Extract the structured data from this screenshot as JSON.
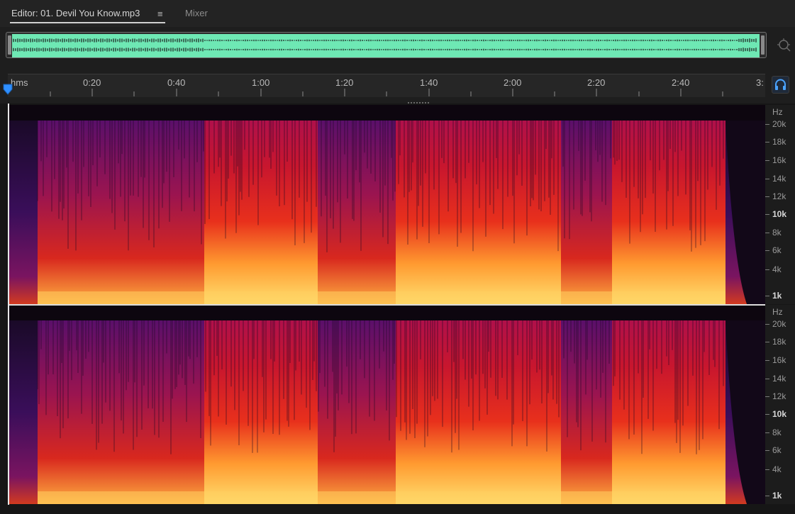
{
  "tabs": {
    "editor_label": "Editor: 01. Devil You Know.mp3",
    "menu_glyph": "≡",
    "mixer_label": "Mixer"
  },
  "icons": {
    "zoom": "zoom-navigator-icon",
    "headphones": "headphones-icon",
    "playhead": "playhead-marker-icon"
  },
  "colors": {
    "waveform": "#6ee8b4",
    "accent": "#2f8fff",
    "spec_low": "#0d060f",
    "spec_mid": "#d21e2a",
    "spec_high": "#ffd060"
  },
  "ruler": {
    "unit_label": "hms",
    "labels": [
      "0:20",
      "0:40",
      "1:00",
      "1:20",
      "1:40",
      "2:00",
      "2:20",
      "2:40",
      "3:"
    ]
  },
  "hz_scale": {
    "unit": "Hz",
    "labels": [
      "20k",
      "18k",
      "16k",
      "14k",
      "12k",
      "10k",
      "8k",
      "6k",
      "4k",
      "1k"
    ]
  }
}
